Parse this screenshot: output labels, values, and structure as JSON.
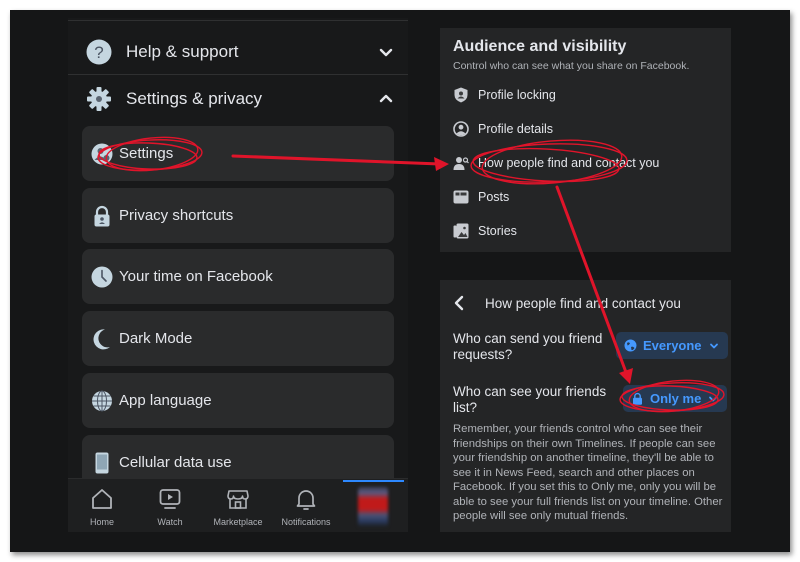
{
  "left_panel": {
    "sections": [
      {
        "label": "Help & support",
        "icon": "help-icon",
        "expanded": false
      },
      {
        "label": "Settings & privacy",
        "icon": "gear-icon",
        "expanded": true
      }
    ],
    "items": [
      {
        "label": "Settings",
        "icon": "user-settings-icon",
        "highlighted": true
      },
      {
        "label": "Privacy shortcuts",
        "icon": "lock-icon"
      },
      {
        "label": "Your time on Facebook",
        "icon": "clock-icon"
      },
      {
        "label": "Dark Mode",
        "icon": "moon-icon"
      },
      {
        "label": "App language",
        "icon": "globe-icon"
      },
      {
        "label": "Cellular data use",
        "icon": "phone-icon"
      }
    ],
    "bottom_nav": [
      {
        "label": "Home",
        "icon": "home-icon"
      },
      {
        "label": "Watch",
        "icon": "watch-icon"
      },
      {
        "label": "Marketplace",
        "icon": "marketplace-icon"
      },
      {
        "label": "Notifications",
        "icon": "bell-icon"
      },
      {
        "label": "",
        "icon": "profile-avatar",
        "active": true
      }
    ]
  },
  "audience": {
    "title": "Audience and visibility",
    "subtitle": "Control who can see what you share on Facebook.",
    "items": [
      {
        "label": "Profile locking",
        "icon": "shield-user-icon"
      },
      {
        "label": "Profile details",
        "icon": "user-circle-icon"
      },
      {
        "label": "How people find and contact you",
        "icon": "user-search-icon",
        "highlighted": true
      },
      {
        "label": "Posts",
        "icon": "posts-icon"
      },
      {
        "label": "Stories",
        "icon": "stories-icon"
      }
    ]
  },
  "find_contact": {
    "title": "How people find and contact you",
    "questions": [
      {
        "label": "Who can send you friend requests?",
        "value": "Everyone",
        "icon": "globe-icon"
      },
      {
        "label": "Who can see your friends list?",
        "value": "Only me",
        "icon": "lock-icon",
        "highlighted": true
      }
    ],
    "description": "Remember, your friends control who can see their friendships on their own Timelines. If people can see your friendship on another timeline, they'll be able to see it in News Feed, search and other places on Facebook. If you set this to Only me, only you will be able to see your full friends list on your timeline. Other people will see only mutual friends."
  },
  "colors": {
    "background": "#18191a",
    "card": "#242526",
    "item": "#2a2b2c",
    "text": "#e4e6eb",
    "secondary_text": "#b0b3b8",
    "accent": "#2d88ff",
    "pill_bg": "#263951",
    "annotation": "#e0142a"
  }
}
